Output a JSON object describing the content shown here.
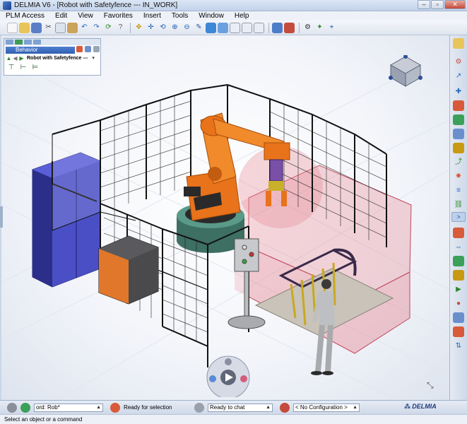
{
  "window": {
    "title": "DELMIA V6 - [Robot with Safetyfence --- IN_WORK]"
  },
  "menu": [
    "PLM Access",
    "Edit",
    "View",
    "Favorites",
    "Insert",
    "Tools",
    "Window",
    "Help"
  ],
  "tree": {
    "tab_label": "Behavior",
    "root_label": "Robot with Safetyfence ---",
    "chevron": "▾"
  },
  "status": {
    "command_value": "ord: Rob*",
    "selection_status": "Ready for selection",
    "chat_status": "Ready to chat",
    "configuration": "< No Configuration >",
    "brand": "DELMIA"
  },
  "message": "Select an object or a command",
  "colors": {
    "accent": "#3164c0",
    "robot": "#e8731a",
    "fence": "#111111",
    "danger_zone": "#e58a96",
    "cabinet": "#3b3fae"
  }
}
